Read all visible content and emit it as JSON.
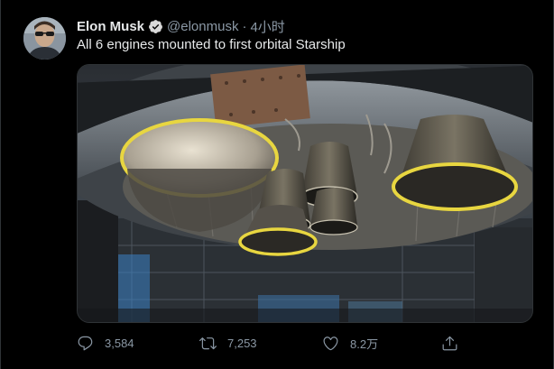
{
  "tweet": {
    "author_name": "Elon Musk",
    "handle": "@elonmusk",
    "separator": "·",
    "time": "4小时",
    "text": "All 6 engines mounted to first orbital Starship",
    "media_description_icon": "rocket-engines-photo"
  },
  "actions": {
    "reply_count": "3,584",
    "retweet_count": "7,253",
    "like_count": "8.2万"
  },
  "colors": {
    "background": "#000000",
    "text_primary": "#e7e9ea",
    "text_secondary": "#8b98a5",
    "verified": "#1d9bf0",
    "engine_ring": "#e8d640"
  }
}
